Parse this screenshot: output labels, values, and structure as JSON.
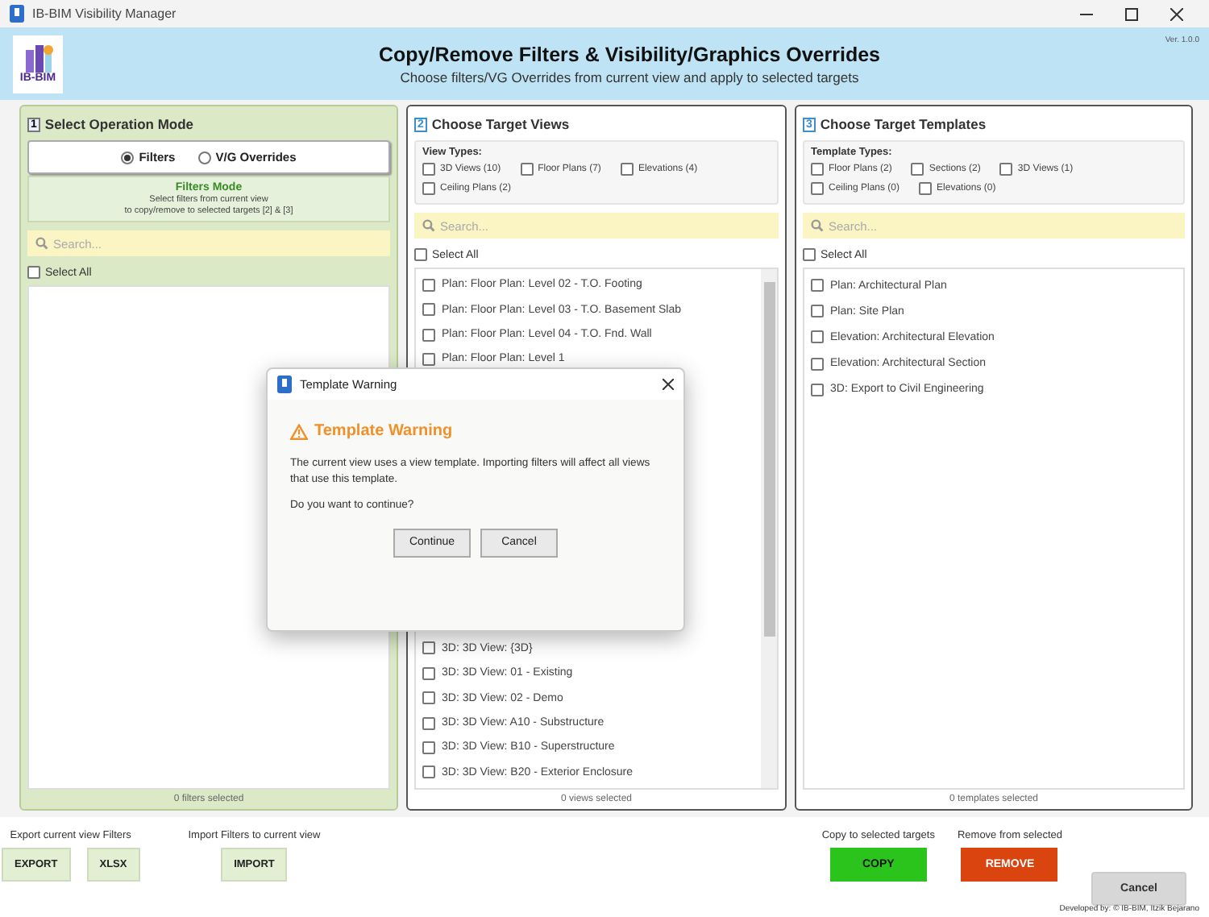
{
  "window": {
    "title": "IB-BIM Visibility Manager"
  },
  "header": {
    "logo_text": "IB-BIM",
    "title": "Copy/Remove Filters & Visibility/Graphics Overrides",
    "subtitle": "Choose filters/VG Overrides from current view and apply to selected targets",
    "version": "Ver. 1.0.0"
  },
  "mode_panel": {
    "number": "1",
    "title": "Select Operation Mode",
    "modes": [
      {
        "label": "Filters",
        "selected": true
      },
      {
        "label": "V/G Overrides",
        "selected": false
      }
    ],
    "mode_title": "Filters Mode",
    "mode_description": [
      "Select filters from current view",
      "to copy/remove to selected targets [2] & [3]"
    ],
    "search": {
      "placeholder": "Search..."
    },
    "select_all": {
      "label": "Select All",
      "checked": false
    },
    "status": "0 filters selected"
  },
  "views_panel": {
    "number": "2",
    "title": "Choose Target Views",
    "types_label": "View Types:",
    "types": [
      {
        "label": "3D Views (10)",
        "checked": false
      },
      {
        "label": "Floor Plans (7)",
        "checked": false
      },
      {
        "label": "Elevations (4)",
        "checked": false
      },
      {
        "label": "Ceiling Plans (2)",
        "checked": false
      }
    ],
    "search": {
      "placeholder": "Search..."
    },
    "select_all": {
      "label": "Select All",
      "checked": false
    },
    "items_top": [
      {
        "label": "Plan: Floor Plan: Level 02 - T.O. Footing",
        "checked": false
      },
      {
        "label": "Plan: Floor Plan: Level 03 - T.O. Basement Slab",
        "checked": false
      },
      {
        "label": "Plan: Floor Plan: Level 04 - T.O. Fnd. Wall",
        "checked": false
      },
      {
        "label": "Plan: Floor Plan: Level 1",
        "checked": false
      }
    ],
    "items_bottom": [
      {
        "label": "3D: 3D View: {3D}",
        "checked": false
      },
      {
        "label": "3D: 3D View: 01 - Existing",
        "checked": false
      },
      {
        "label": "3D: 3D View: 02 - Demo",
        "checked": false
      },
      {
        "label": "3D: 3D View: A10 - Substructure",
        "checked": false
      },
      {
        "label": "3D: 3D View: B10 - Superstructure",
        "checked": false
      },
      {
        "label": "3D: 3D View: B20 - Exterior Enclosure",
        "checked": false
      }
    ],
    "status": "0 views selected"
  },
  "templates_panel": {
    "number": "3",
    "title": "Choose Target Templates",
    "types_label": "Template Types:",
    "types": [
      {
        "label": "Floor Plans (2)",
        "checked": false
      },
      {
        "label": "Sections (2)",
        "checked": false
      },
      {
        "label": "3D Views (1)",
        "checked": false
      },
      {
        "label": "Ceiling Plans (0)",
        "checked": false
      },
      {
        "label": "Elevations (0)",
        "checked": false
      }
    ],
    "search": {
      "placeholder": "Search..."
    },
    "select_all": {
      "label": "Select All",
      "checked": false
    },
    "items": [
      {
        "label": "Plan: Architectural Plan",
        "checked": false
      },
      {
        "label": "Plan: Site Plan",
        "checked": false
      },
      {
        "label": "Elevation: Architectural Elevation",
        "checked": false
      },
      {
        "label": "Elevation: Architectural Section",
        "checked": false
      },
      {
        "label": "3D: Export to Civil Engineering",
        "checked": false
      }
    ],
    "status": "0 templates selected"
  },
  "footer": {
    "export_label": "Export current view Filters",
    "export_buttons": [
      "EXPORT",
      "XLSX"
    ],
    "import_label": "Import Filters to current view",
    "import_button": "IMPORT",
    "copy_label": "Copy to selected targets",
    "copy_button": "COPY",
    "remove_label": "Remove from selected",
    "remove_button": "REMOVE",
    "cancel_button": "Cancel",
    "credit": "Developed by: © IB-BIM, Itzik Bejarano"
  },
  "dialog": {
    "title": "Template Warning",
    "heading": "Template Warning",
    "message": "The current view uses a view template. Importing filters will affect all views that use this template.",
    "question": "Do you want to continue?",
    "buttons": [
      "Continue",
      "Cancel"
    ]
  }
}
